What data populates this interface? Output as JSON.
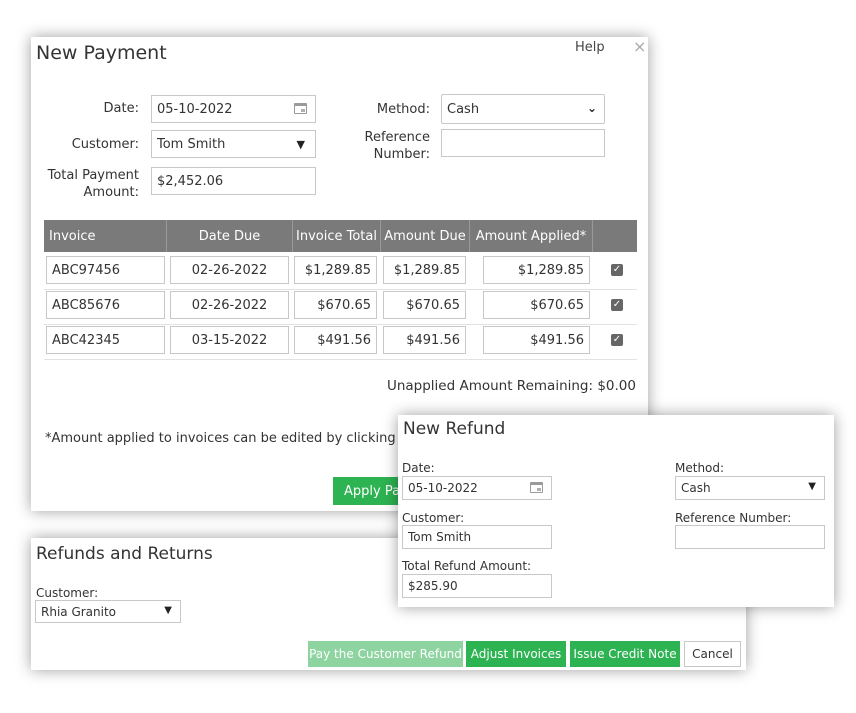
{
  "new_payment": {
    "title": "New Payment",
    "help_label": "Help",
    "close_glyph": "×",
    "date_label": "Date:",
    "date_value": "05-10-2022",
    "customer_label": "Customer:",
    "customer_value": "Tom Smith",
    "total_label_line1": "Total Payment",
    "total_label_line2": "Amount:",
    "total_value": "$2,452.06",
    "method_label": "Method:",
    "method_value": "Cash",
    "reference_label_line1": "Reference",
    "reference_label_line2": "Number:",
    "reference_value": "",
    "table": {
      "headers": [
        "Invoice",
        "Date Due",
        "Invoice Total",
        "Amount Due",
        "Amount Applied*"
      ],
      "rows": [
        {
          "invoice": "ABC97456",
          "date_due": "02-26-2022",
          "invoice_total": "$1,289.85",
          "amount_due": "$1,289.85",
          "amount_applied": "$1,289.85",
          "checked": true
        },
        {
          "invoice": "ABC85676",
          "date_due": "02-26-2022",
          "invoice_total": "$670.65",
          "amount_due": "$670.65",
          "amount_applied": "$670.65",
          "checked": true
        },
        {
          "invoice": "ABC42345",
          "date_due": "03-15-2022",
          "invoice_total": "$491.56",
          "amount_due": "$491.56",
          "amount_applied": "$491.56",
          "checked": true
        }
      ]
    },
    "unapplied_text": "Unapplied Amount Remaining: $0.00",
    "footnote": "*Amount applied to invoices can be edited by clicking in th",
    "apply_button": "Apply Pa"
  },
  "refunds": {
    "title": "Refunds and Returns",
    "customer_label": "Customer:",
    "customer_value": "Rhia Granito",
    "buttons": {
      "pay_refund": "Pay the Customer Refund",
      "adjust_invoices": "Adjust Invoices",
      "issue_credit": "Issue Credit Note",
      "cancel": "Cancel"
    }
  },
  "new_refund": {
    "title": "New Refund",
    "date_label": "Date:",
    "date_value": "05-10-2022",
    "customer_label": "Customer:",
    "customer_value": "Tom Smith",
    "total_label": "Total Refund Amount:",
    "total_value": "$285.90",
    "method_label": "Method:",
    "method_value": "Cash",
    "reference_label": "Reference Number:",
    "reference_value": ""
  },
  "colors": {
    "green": "#2db352",
    "green_light": "#8dd4a0",
    "table_header": "#7a7a7a"
  }
}
